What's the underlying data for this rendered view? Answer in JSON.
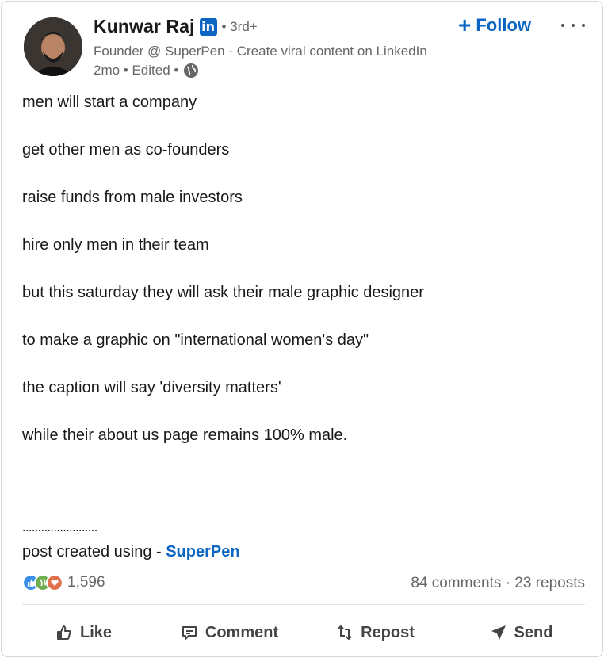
{
  "author": {
    "name": "Kunwar Raj",
    "badge": "in",
    "degree": "• 3rd+",
    "headline": "Founder @ SuperPen - Create viral content on LinkedIn",
    "meta": "2mo • Edited •"
  },
  "header": {
    "follow_label": "Follow",
    "follow_plus": "+"
  },
  "post": {
    "lines": [
      "men will start a company",
      "get other men as co-founders",
      "raise funds from male investors",
      "hire only men in their team",
      "but this saturday they will ask their male graphic designer",
      "to make a graphic on \"international women's day\"",
      "the caption will say 'diversity matters'",
      "while their about us page remains 100% male."
    ],
    "separator": "........................",
    "credit_prefix": "post created using - ",
    "credit_link": "SuperPen"
  },
  "social": {
    "reaction_count": "1,596",
    "comments": "84 comments",
    "separator": " · ",
    "reposts": "23 reposts",
    "reaction_icons": [
      "like-reaction-icon",
      "celebrate-reaction-icon",
      "love-reaction-icon"
    ]
  },
  "actions": {
    "like": "Like",
    "comment": "Comment",
    "repost": "Repost",
    "send": "Send"
  },
  "colors": {
    "accent": "#0a66c2",
    "text": "#191919",
    "muted": "#666666"
  }
}
